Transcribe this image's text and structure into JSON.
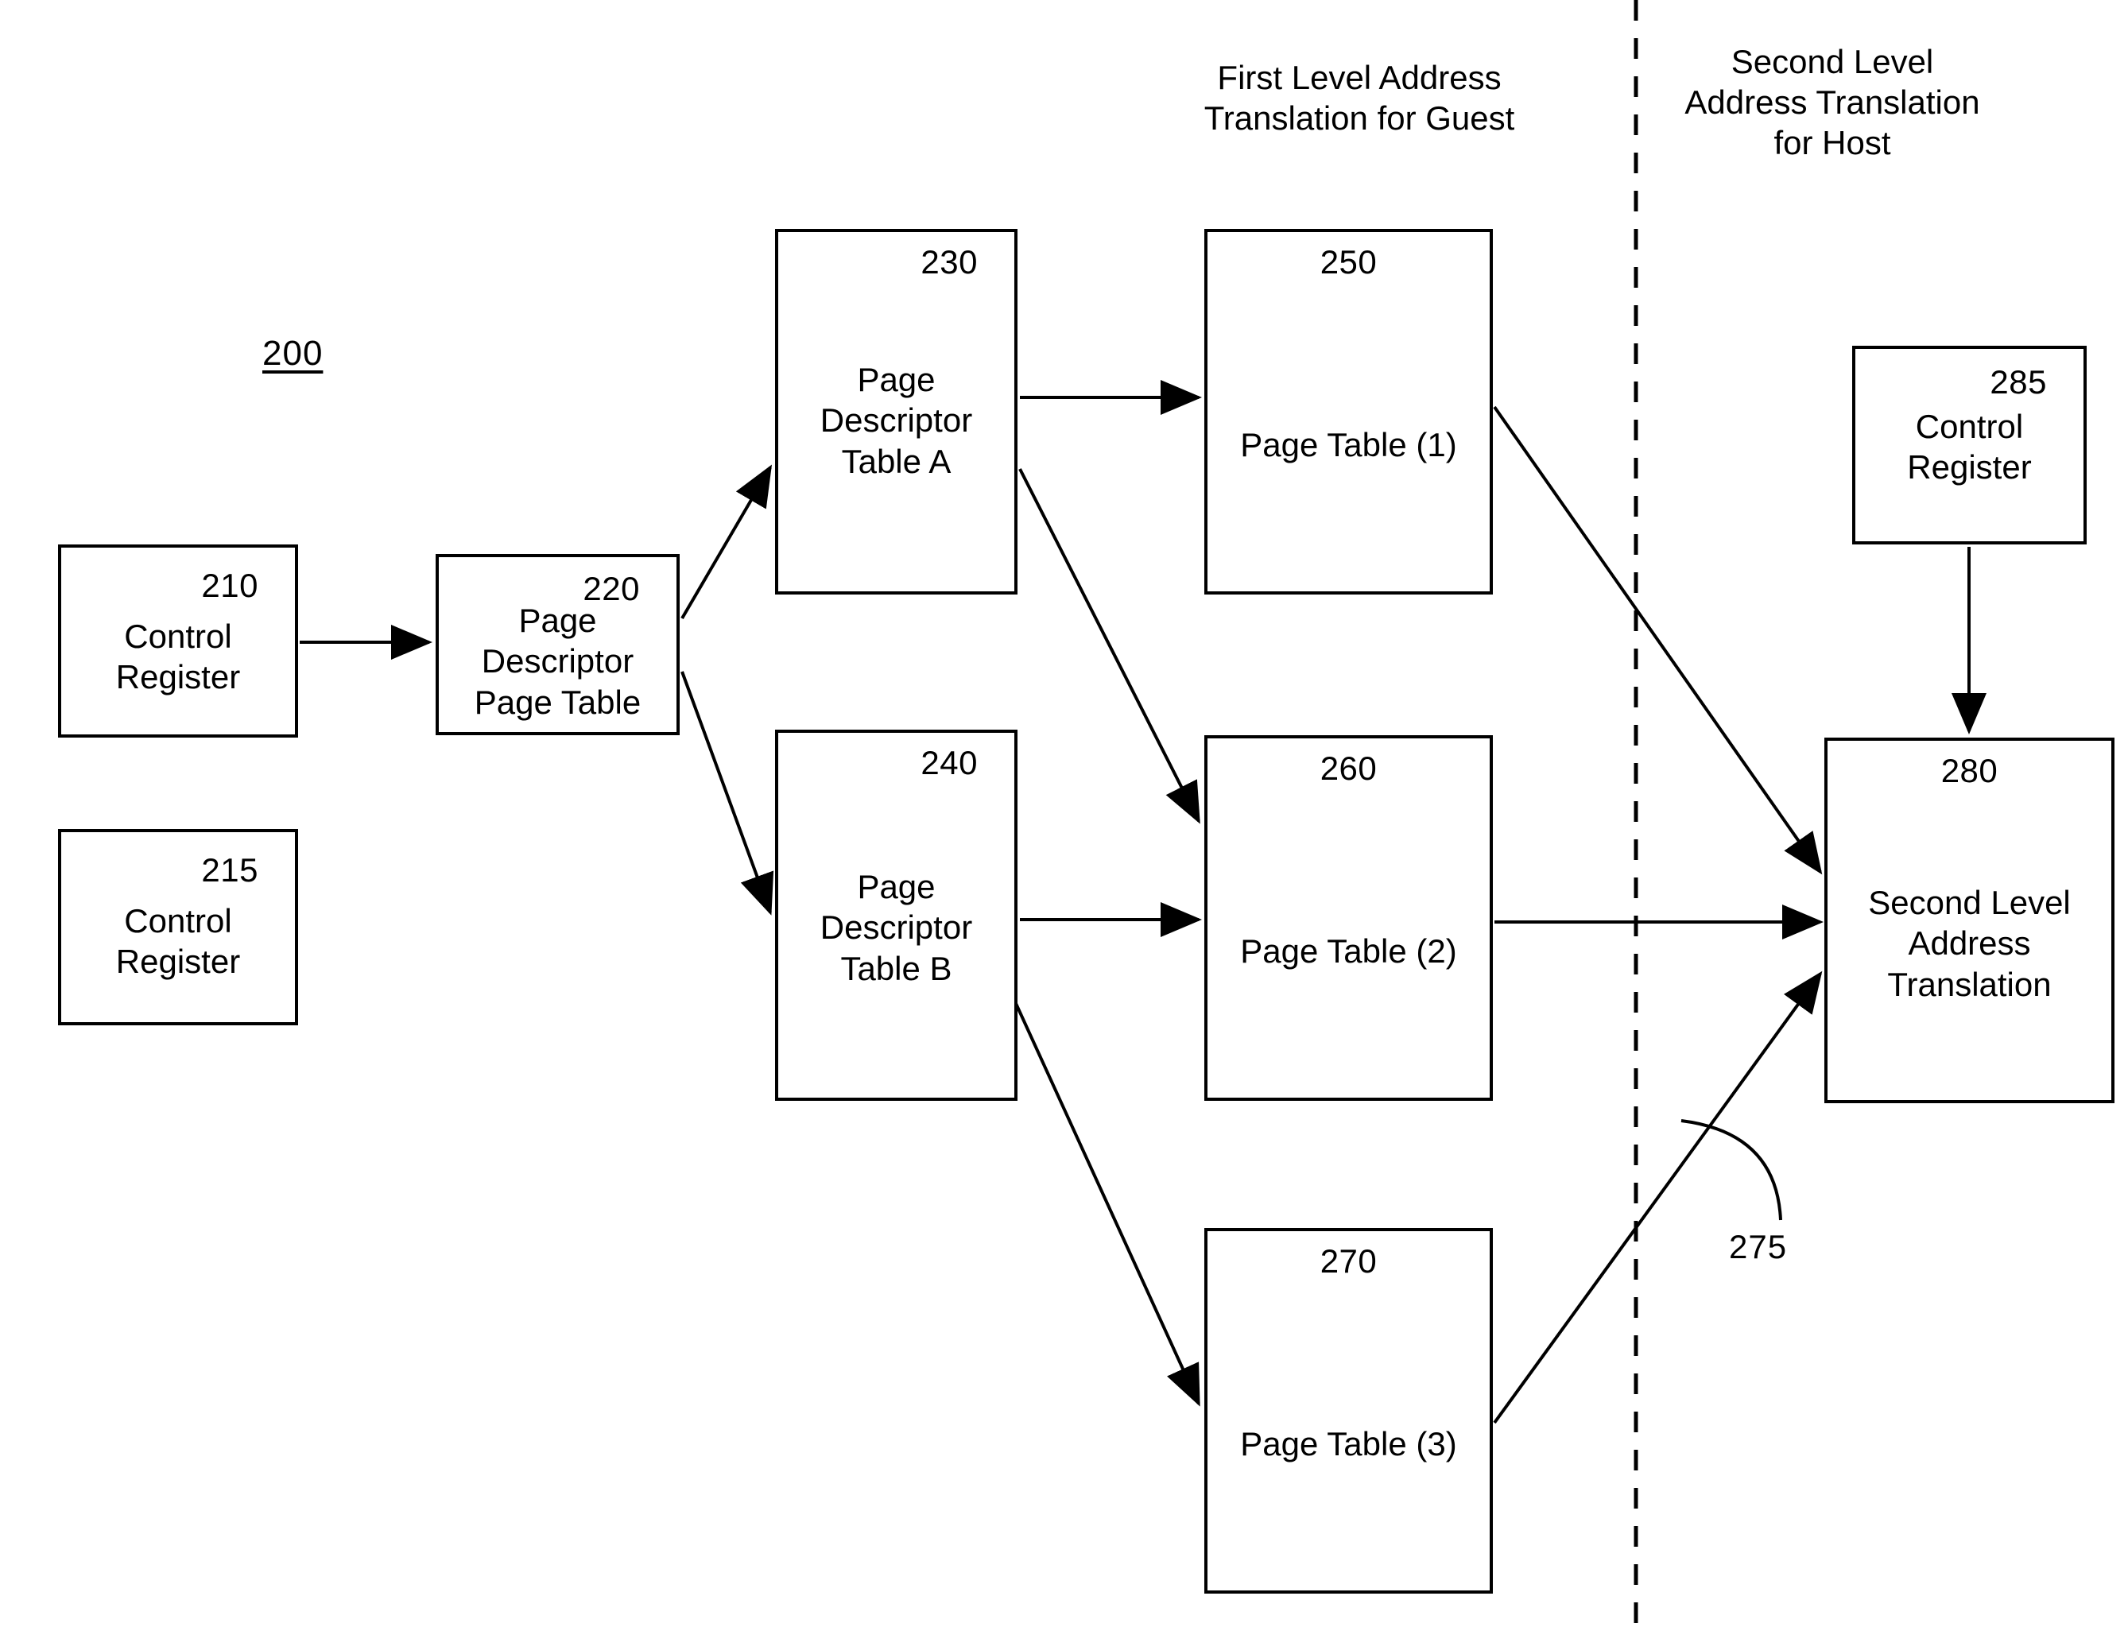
{
  "figure": {
    "reference_numeral": "200"
  },
  "captions": {
    "first_level": "First Level Address\nTranslation for Guest",
    "second_level": "Second Level\nAddress Translation\nfor Host"
  },
  "divider": {
    "style": "dashed",
    "color": "#000000"
  },
  "nodes": [
    {
      "id": "210",
      "ref": "210",
      "label": "Control\nRegister",
      "ref_align": "right"
    },
    {
      "id": "215",
      "ref": "215",
      "label": "Control\nRegister",
      "ref_align": "right"
    },
    {
      "id": "220",
      "ref": "220",
      "label": "Page\nDescriptor\nPage Table",
      "ref_align": "right"
    },
    {
      "id": "230",
      "ref": "230",
      "label": "Page\nDescriptor\nTable A",
      "ref_align": "right"
    },
    {
      "id": "240",
      "ref": "240",
      "label": "Page\nDescriptor\nTable B",
      "ref_align": "right"
    },
    {
      "id": "250",
      "ref": "250",
      "label": "Page Table (1)",
      "ref_align": "center"
    },
    {
      "id": "260",
      "ref": "260",
      "label": "Page Table (2)",
      "ref_align": "center"
    },
    {
      "id": "270",
      "ref": "270",
      "label": "Page Table (3)",
      "ref_align": "center"
    },
    {
      "id": "280",
      "ref": "280",
      "label": "Second Level\nAddress\nTranslation",
      "ref_align": "center"
    },
    {
      "id": "285",
      "ref": "285",
      "label": "Control\nRegister",
      "ref_align": "right"
    }
  ],
  "leader_labels": [
    {
      "ref": "275",
      "describes": "second-level-translation-inbound-edge"
    }
  ],
  "edges": [
    {
      "from": "210",
      "to": "220",
      "kind": "straight-arrow"
    },
    {
      "from": "220",
      "to": "230",
      "kind": "diagonal-arrow"
    },
    {
      "from": "220",
      "to": "240",
      "kind": "diagonal-arrow"
    },
    {
      "from": "230",
      "to": "250",
      "kind": "straight-arrow"
    },
    {
      "from": "230",
      "to": "260",
      "kind": "diagonal-arrow"
    },
    {
      "from": "240",
      "to": "260",
      "kind": "straight-arrow"
    },
    {
      "from": "240",
      "to": "270",
      "kind": "diagonal-arrow"
    },
    {
      "from": "250",
      "to": "280",
      "kind": "diagonal-arrow"
    },
    {
      "from": "260",
      "to": "280",
      "kind": "straight-arrow"
    },
    {
      "from": "270",
      "to": "280",
      "kind": "diagonal-arrow"
    },
    {
      "from": "285",
      "to": "280",
      "kind": "straight-arrow"
    }
  ],
  "style": {
    "stroke": "#000000",
    "background": "#ffffff",
    "stroke_width": 4
  }
}
